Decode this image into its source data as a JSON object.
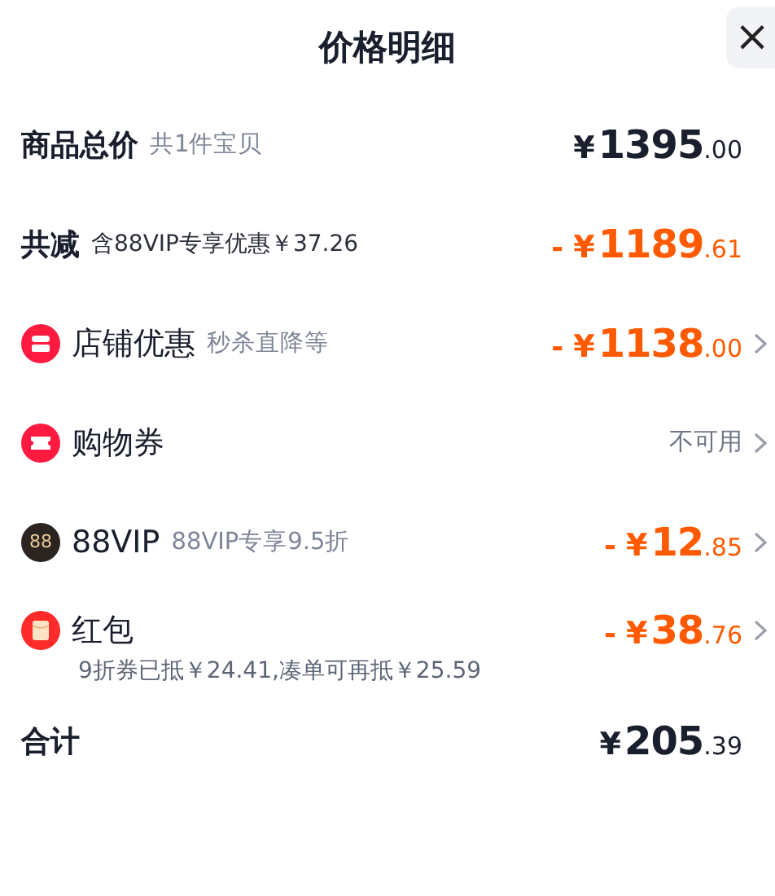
{
  "header": {
    "title": "价格明细",
    "close": "×"
  },
  "rows": [
    {
      "kind": "summary",
      "label": "商品总价",
      "note": "共1件宝贝",
      "note_dark": false,
      "amount": {
        "discount": false,
        "currency": "¥",
        "integer": "1395",
        "decimal": ".00"
      },
      "chevron": false
    },
    {
      "kind": "summary",
      "label": "共减",
      "note": "含88VIP专享优惠￥37.26",
      "note_dark": true,
      "amount": {
        "discount": true,
        "sign": "-",
        "currency": "¥",
        "integer": "1189",
        "decimal": ".61"
      },
      "chevron": false
    },
    {
      "kind": "store",
      "label": "店铺优惠",
      "note": "秒杀直降等",
      "amount": {
        "discount": true,
        "sign": "-",
        "currency": "¥",
        "integer": "1138",
        "decimal": ".00"
      },
      "chevron": true
    },
    {
      "kind": "coupon",
      "label": "购物券",
      "status": "不可用",
      "chevron": true
    },
    {
      "kind": "vip",
      "badge": "88",
      "label": "88VIP",
      "note": "88VIP专享9.5折",
      "amount": {
        "discount": true,
        "sign": "-",
        "currency": "¥",
        "integer": "12",
        "decimal": ".85"
      },
      "chevron": true
    },
    {
      "kind": "envelope",
      "label": "红包",
      "detail": "9折券已抵￥24.41,凑单可再抵￥25.59",
      "amount": {
        "discount": true,
        "sign": "-",
        "currency": "¥",
        "integer": "38",
        "decimal": ".76"
      },
      "chevron": true
    },
    {
      "kind": "summary",
      "label": "合计",
      "amount": {
        "discount": false,
        "currency": "¥",
        "integer": "205",
        "decimal": ".39"
      },
      "chevron": false
    }
  ]
}
